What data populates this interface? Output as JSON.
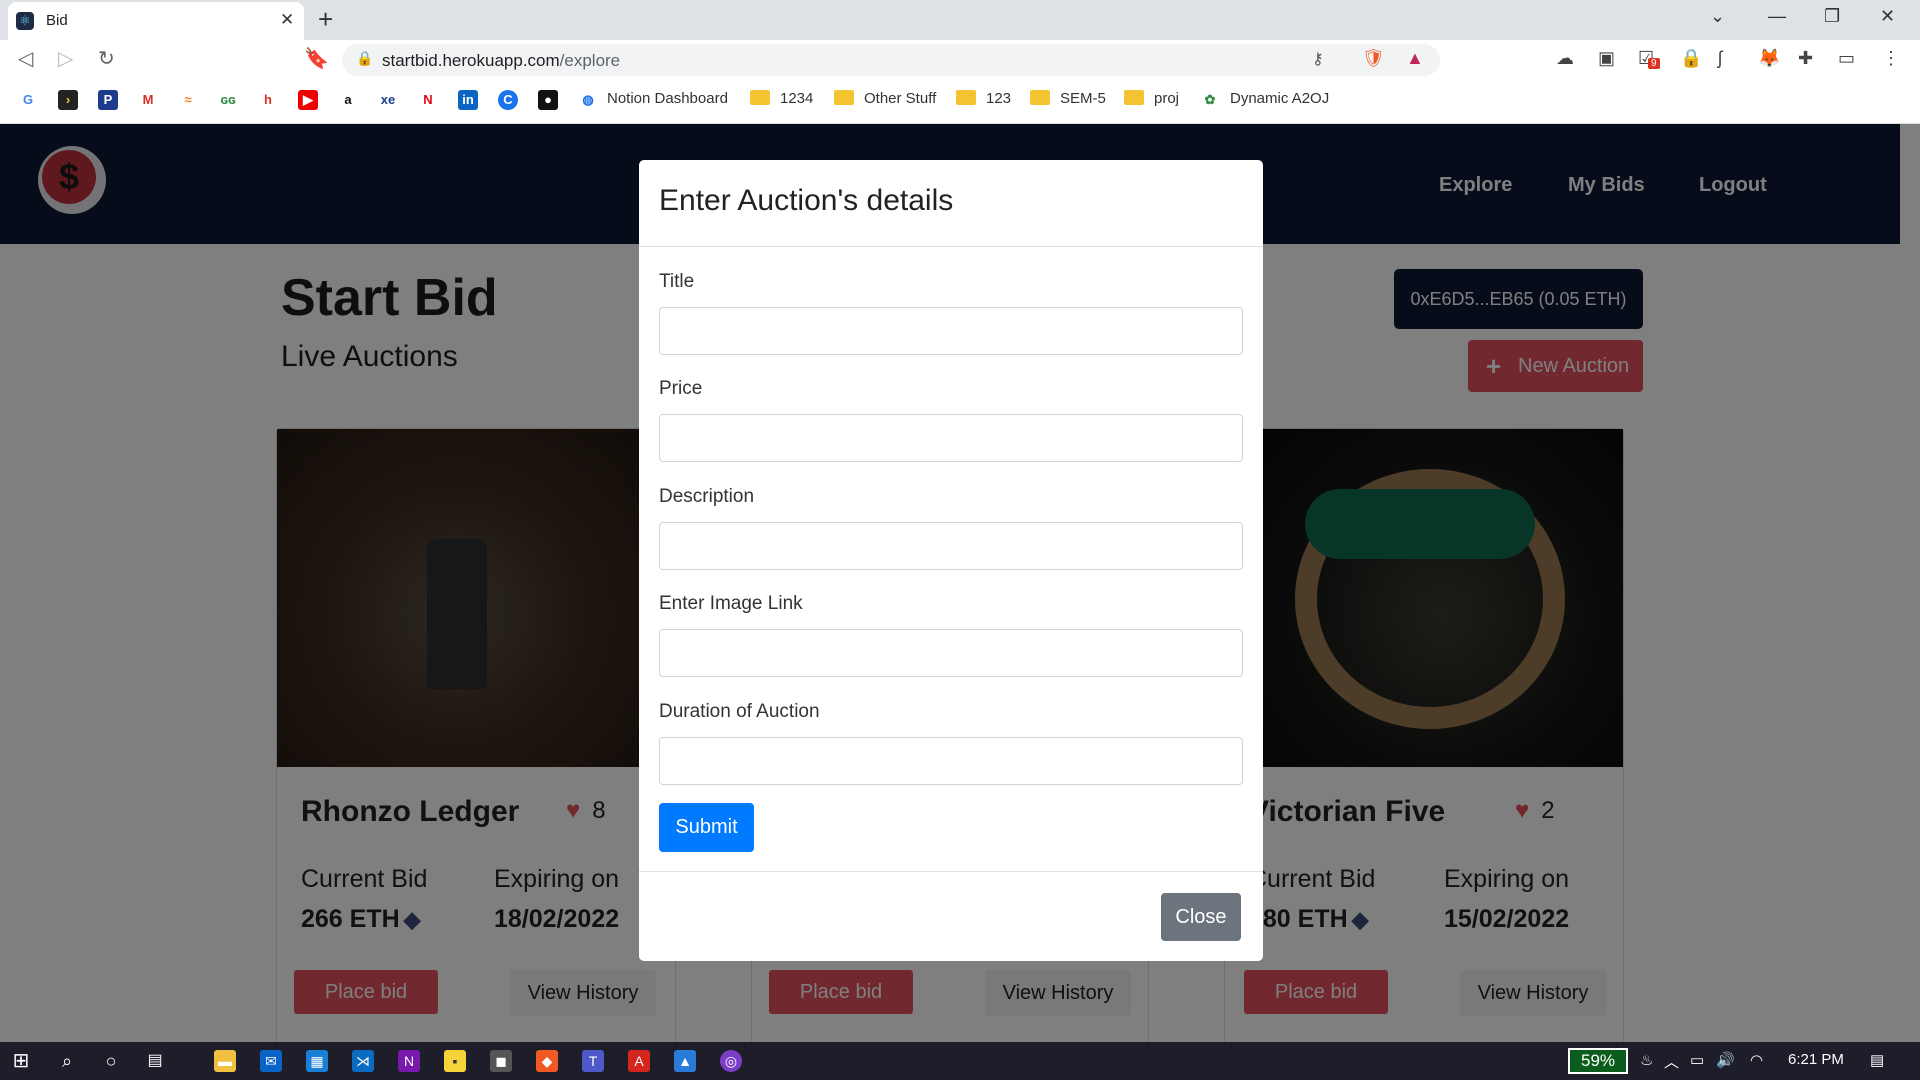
{
  "browser": {
    "tab_title": "Bid",
    "url_domain": "startbid.herokuapp.com",
    "url_path": "/explore",
    "bookmarks": [
      "Notion Dashboard",
      "1234",
      "Other Stuff",
      "123",
      "SEM-5",
      "proj",
      "Dynamic A2OJ"
    ],
    "ext_badge": "9"
  },
  "nav": {
    "links": [
      "Explore",
      "My Bids",
      "Logout"
    ]
  },
  "page": {
    "title": "Start Bid",
    "subtitle": "Live Auctions",
    "wallet": "0xE6D5...EB65 (0.05 ETH)",
    "new_auction": "New Auction"
  },
  "cards": [
    {
      "title": "Rhonzo Ledger",
      "likes": "8",
      "bid_label": "Current Bid",
      "bid": "266 ETH",
      "exp_label": "Expiring on",
      "date": "18/02/2022",
      "place": "Place bid",
      "history": "View History"
    },
    {
      "title": "",
      "likes": "",
      "bid_label": "",
      "bid": "",
      "exp_label": "",
      "date": "",
      "place": "Place bid",
      "history": "View History"
    },
    {
      "title": "Victorian Five",
      "likes": "2",
      "bid_label": "Current Bid",
      "bid": "680 ETH",
      "exp_label": "Expiring on",
      "date": "15/02/2022",
      "place": "Place bid",
      "history": "View History"
    }
  ],
  "modal": {
    "title": "Enter Auction's details",
    "fields": [
      {
        "label": "Title",
        "value": ""
      },
      {
        "label": "Price",
        "value": ""
      },
      {
        "label": "Description",
        "value": ""
      },
      {
        "label": "Enter Image Link",
        "value": ""
      },
      {
        "label": "Duration of Auction",
        "value": ""
      }
    ],
    "submit": "Submit",
    "close": "Close"
  },
  "taskbar": {
    "battery": "59%",
    "time": "6:21 PM"
  }
}
